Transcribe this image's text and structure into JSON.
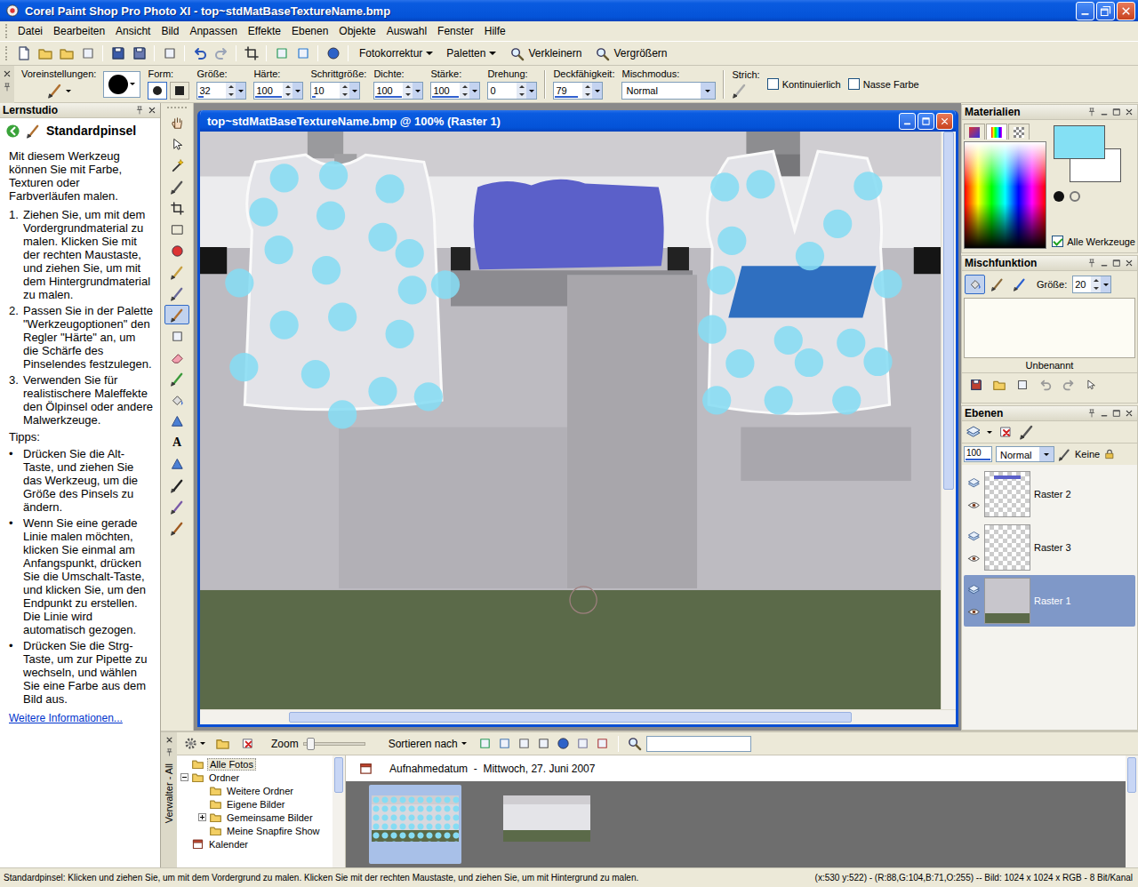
{
  "window": {
    "title": "Corel Paint Shop Pro Photo XI - top~stdMatBaseTextureName.bmp"
  },
  "menu": [
    "Datei",
    "Bearbeiten",
    "Ansicht",
    "Bild",
    "Anpassen",
    "Effekte",
    "Ebenen",
    "Objekte",
    "Auswahl",
    "Fenster",
    "Hilfe"
  ],
  "toolbar": {
    "dropdowns": [
      "Fotokorrektur",
      "Paletten"
    ],
    "zoom": [
      "Verkleinern",
      "Vergrößern"
    ]
  },
  "tool_options": {
    "preset_label": "Voreinstellungen:",
    "shape": {
      "label": "Form:",
      "options": [
        {
          "kind": "round",
          "selected": true
        },
        {
          "kind": "square",
          "selected": false
        }
      ]
    },
    "spinners": [
      {
        "label": "Größe:",
        "value": "32",
        "level": 0.16
      },
      {
        "label": "Härte:",
        "value": "100",
        "level": 1
      },
      {
        "label": "Schrittgröße:",
        "value": "10",
        "level": 0.1
      },
      {
        "label": "Dichte:",
        "value": "100",
        "level": 1
      },
      {
        "label": "Stärke:",
        "value": "100",
        "level": 1
      },
      {
        "label": "Drehung:",
        "value": "0",
        "level": 0
      }
    ],
    "opacity": {
      "label": "Deckfähigkeit:",
      "value": "79",
      "level": 0.79
    },
    "blend": {
      "label": "Mischmodus:",
      "value": "Normal"
    },
    "stroke_label": "Strich:",
    "checkboxes": [
      {
        "label": "Kontinuierlich",
        "checked": false
      },
      {
        "label": "Nasse Farbe",
        "checked": false
      }
    ]
  },
  "learning_center": {
    "title": "Lernstudio",
    "tool": "Standardpinsel",
    "intro": "Mit diesem Werkzeug können Sie mit Farbe, Texturen oder Farbverläufen malen.",
    "steps": [
      {
        "number": "1.",
        "text": "Ziehen Sie, um mit dem Vordergrundmaterial zu malen. Klicken Sie mit der rechten Maustaste, und ziehen Sie, um mit dem Hintergrundmaterial zu malen."
      },
      {
        "number": "2.",
        "text": "Passen Sie in der Palette \"Werkzeugoptionen\" den Regler \"Härte\" an, um die Schärfe des Pinselendes festzulegen."
      },
      {
        "number": "3.",
        "text": "Verwenden Sie für realistischere Maleffekte den Ölpinsel oder andere Malwerkzeuge."
      }
    ],
    "tips_title": "Tipps:",
    "tips": [
      {
        "bullet": "•",
        "text": "Drücken Sie die Alt-Taste, und ziehen Sie das Werkzeug, um die Größe des Pinsels zu ändern."
      },
      {
        "bullet": "•",
        "text": "Wenn Sie eine gerade Linie malen möchten, klicken Sie einmal am Anfangspunkt, drücken Sie die Umschalt-Taste, und klicken Sie, um den Endpunkt zu erstellen. Die Linie wird automatisch gezogen."
      },
      {
        "bullet": "•",
        "text": "Drücken Sie die Strg-Taste, um zur Pipette zu wechseln, und wählen Sie eine Farbe aus dem Bild aus."
      }
    ],
    "link": "Weitere Informationen..."
  },
  "tools": [
    {
      "selected": false
    },
    {
      "selected": false
    },
    {
      "selected": false
    },
    {
      "selected": false
    },
    {
      "selected": false
    },
    {
      "selected": false
    },
    {
      "selected": false
    },
    {
      "selected": false
    },
    {
      "selected": false
    },
    {
      "selected": true
    },
    {
      "selected": false
    },
    {
      "selected": false
    },
    {
      "selected": false
    },
    {
      "selected": false
    },
    {
      "selected": false
    },
    {
      "glyph": "A",
      "selected": false
    },
    {
      "selected": false
    },
    {
      "selected": false
    },
    {
      "selected": false
    },
    {
      "selected": false
    }
  ],
  "image_window": {
    "title": "top~stdMatBaseTextureName.bmp @ 100% (Raster 1)",
    "scroll": {
      "vertical": {
        "start": 0,
        "length": 0.62
      },
      "horizontal": {
        "start": 0.12,
        "length": 0.76
      }
    }
  },
  "materials": {
    "title": "Materialien",
    "tabs": [
      {
        "selected": false
      },
      {
        "selected": true
      },
      {
        "selected": false
      }
    ],
    "swatches": [
      {
        "role": "foreground",
        "color": "#84e0f4"
      },
      {
        "role": "background",
        "color": "#ffffff"
      }
    ],
    "all_tools": {
      "label": "Alle Werkzeuge",
      "checked": true
    }
  },
  "mixer": {
    "title": "Mischfunktion",
    "tools": [
      {
        "selected": true
      },
      {
        "selected": false
      },
      {
        "selected": false
      }
    ],
    "size_label": "Größe:",
    "size": "20",
    "name": "Unbenannt"
  },
  "layers": {
    "title": "Ebenen",
    "opacity": "100",
    "blend": "Normal",
    "mask": "Keine",
    "items": [
      {
        "name": "Raster 2",
        "kind": "overlay",
        "visible": true,
        "selected": false
      },
      {
        "name": "Raster 3",
        "kind": "empty",
        "visible": true,
        "selected": false
      },
      {
        "name": "Raster 1",
        "kind": "image",
        "visible": true,
        "selected": true
      }
    ]
  },
  "organizer": {
    "title": "Verwalter - All",
    "zoom_label": "Zoom",
    "zoom_level": 0.05,
    "sort_label": "Sortieren nach",
    "search": "",
    "tree": [
      {
        "label": "Alle Fotos",
        "kind": "folder",
        "selected": true,
        "expanded": false,
        "has_children": false
      },
      {
        "label": "Ordner",
        "kind": "folder",
        "selected": false,
        "expanded": true,
        "has_children": true,
        "children": [
          {
            "label": "Weitere Ordner",
            "kind": "folder",
            "selected": false,
            "expanded": false,
            "has_children": false
          },
          {
            "label": "Eigene Bilder",
            "kind": "folder",
            "selected": false,
            "expanded": false,
            "has_children": false
          },
          {
            "label": "Gemeinsame Bilder",
            "kind": "folder",
            "selected": false,
            "expanded": false,
            "has_children": true
          },
          {
            "label": "Meine Snapfire Show",
            "kind": "folder",
            "selected": false,
            "expanded": false,
            "has_children": false
          }
        ]
      },
      {
        "label": "Kalender",
        "kind": "calendar",
        "selected": false,
        "expanded": false,
        "has_children": false
      }
    ],
    "date_header": "Aufnahmedatum  -  Mittwoch, 27. Juni 2007",
    "thumbnails": [
      {
        "kind": "painted",
        "selected": true
      },
      {
        "kind": "plain",
        "selected": false
      }
    ]
  },
  "status_bar": {
    "hint": "Standardpinsel: Klicken und ziehen Sie, um mit dem Vordergrund zu malen. Klicken Sie mit der rechten Maustaste, und ziehen Sie, um mit Hintergrund zu malen.",
    "info": "(x:530 y:522) - (R:88,G:104,B:71,O:255) -- Bild:  1024 x 1024 x RGB - 8 Bit/Kanal"
  }
}
